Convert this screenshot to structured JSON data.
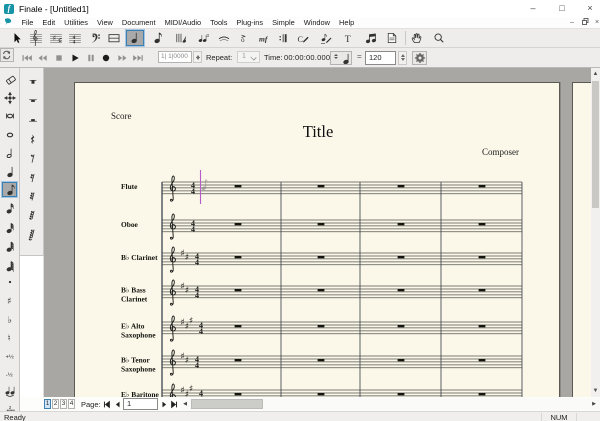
{
  "window": {
    "title": "Finale - [Untitled1]",
    "controls": {
      "minimize": "–",
      "maximize": "□",
      "close": "×"
    }
  },
  "menubar": {
    "items": [
      "File",
      "Edit",
      "Utilities",
      "View",
      "Document",
      "MIDI/Audio",
      "Tools",
      "Plug-ins",
      "Simple",
      "Window",
      "Help"
    ],
    "child_controls": {
      "minimize": "–",
      "restore": "▫",
      "close": "×"
    }
  },
  "toolbar_main": {
    "buttons": [
      {
        "name": "selection-tool",
        "icon": "cursor-arrow",
        "selected": false
      },
      {
        "name": "staff-tool",
        "icon": "treble-staff",
        "selected": false
      },
      {
        "name": "key-signature-tool",
        "icon": "key-signature-staff",
        "selected": false
      },
      {
        "name": "time-signature-tool",
        "icon": "time-signature-staff",
        "selected": false
      },
      {
        "name": "clef-tool",
        "icon": "bass-clef",
        "selected": false
      },
      {
        "name": "measure-tool",
        "icon": "measure-box",
        "selected": false
      },
      {
        "name": "simple-entry-tool",
        "icon": "quarter-note",
        "selected": true
      },
      {
        "name": "speedy-entry-tool",
        "icon": "eighth-note",
        "selected": false
      },
      {
        "name": "hyperscribe-tool",
        "icon": "hyperscribe",
        "selected": false
      },
      {
        "name": "tuplet-tool",
        "icon": "tuplet",
        "selected": false
      },
      {
        "name": "smart-shape-tool",
        "icon": "slur",
        "selected": false
      },
      {
        "name": "articulation-tool",
        "icon": "articulation",
        "selected": false
      },
      {
        "name": "expression-tool",
        "icon": "mf",
        "selected": false
      },
      {
        "name": "repeat-tool",
        "icon": "repeat-barline",
        "selected": false
      },
      {
        "name": "chord-tool",
        "icon": "chord",
        "selected": false
      },
      {
        "name": "lyrics-tool",
        "icon": "lyrics",
        "selected": false
      },
      {
        "name": "text-tool",
        "icon": "letter-t",
        "selected": false
      },
      {
        "name": "note-mover-tool",
        "icon": "beamed-notes",
        "selected": false
      },
      {
        "name": "page-layout-tool",
        "icon": "page",
        "selected": false
      },
      {
        "name": "hand-grabber-tool",
        "icon": "hand",
        "selected": false
      },
      {
        "name": "zoom-tool",
        "icon": "magnifier",
        "selected": false
      }
    ]
  },
  "toolbar_playback": {
    "loop_icon": "loop",
    "transport": [
      {
        "name": "skip-to-start",
        "icon": "skip-start",
        "enabled": false
      },
      {
        "name": "rewind",
        "icon": "rewind",
        "enabled": false
      },
      {
        "name": "stop",
        "icon": "stop",
        "enabled": false
      },
      {
        "name": "play",
        "icon": "play",
        "enabled": true
      },
      {
        "name": "pause",
        "icon": "pause",
        "enabled": false
      },
      {
        "name": "record",
        "icon": "record",
        "enabled": true
      },
      {
        "name": "fast-forward",
        "icon": "fast-forward",
        "enabled": false
      },
      {
        "name": "skip-to-end",
        "icon": "skip-end",
        "enabled": false
      }
    ],
    "counter_value": "1| 1|0000",
    "repeat_label": "Repeat:",
    "repeat_value": "1",
    "time_label": "Time:",
    "time_value": "00:00:00.000",
    "tempo_unit_icon": "quarter-note",
    "tempo_equals": "=",
    "tempo_value": "120",
    "settings_icon": "gear"
  },
  "palette_simple_entry": {
    "buttons": [
      {
        "name": "eraser",
        "icon": "eraser",
        "selected": false
      },
      {
        "name": "repitch",
        "icon": "move-arrows",
        "selected": false
      },
      {
        "name": "double-whole-note",
        "icon": "double-whole-note",
        "selected": false
      },
      {
        "name": "whole-note",
        "icon": "whole-note",
        "selected": false
      },
      {
        "name": "half-note",
        "icon": "half-note",
        "selected": false
      },
      {
        "name": "quarter-note",
        "icon": "quarter-note",
        "selected": false
      },
      {
        "name": "eighth-note",
        "icon": "eighth-note",
        "selected": true
      },
      {
        "name": "sixteenth-note",
        "icon": "sixteenth-note",
        "selected": false
      },
      {
        "name": "thirty-second-note",
        "icon": "thirty-second-note",
        "selected": false
      },
      {
        "name": "sixty-fourth-note",
        "icon": "sixty-fourth-note",
        "selected": false
      },
      {
        "name": "hundred-twenty-eighth-note",
        "icon": "hundred-twenty-eighth-note",
        "selected": false
      },
      {
        "name": "augmentation-dot",
        "icon": "dot",
        "selected": false
      },
      {
        "name": "sharp",
        "icon": "sharp",
        "selected": false
      },
      {
        "name": "flat",
        "icon": "flat",
        "selected": false
      },
      {
        "name": "natural",
        "icon": "natural",
        "selected": false
      },
      {
        "name": "half-step-up",
        "icon": "half-step-up",
        "selected": false
      },
      {
        "name": "half-step-down",
        "icon": "half-step-down",
        "selected": false
      },
      {
        "name": "tie",
        "icon": "tie",
        "selected": false
      },
      {
        "name": "tuplet",
        "icon": "tuplet-notes",
        "selected": false
      }
    ],
    "half_step_up_label": "+½",
    "half_step_down_label": "-½"
  },
  "palette_rests": {
    "buttons": [
      {
        "name": "double-whole-rest",
        "icon": "double-whole-rest"
      },
      {
        "name": "whole-rest",
        "icon": "whole-rest"
      },
      {
        "name": "half-rest",
        "icon": "half-rest"
      },
      {
        "name": "quarter-rest",
        "icon": "quarter-rest"
      },
      {
        "name": "eighth-rest",
        "icon": "eighth-rest"
      },
      {
        "name": "sixteenth-rest",
        "icon": "sixteenth-rest"
      },
      {
        "name": "thirty-second-rest",
        "icon": "thirty-second-rest"
      },
      {
        "name": "sixty-fourth-rest",
        "icon": "sixty-fourth-rest"
      },
      {
        "name": "hundred-twenty-eighth-rest",
        "icon": "hundred-twenty-eighth-rest"
      }
    ]
  },
  "document": {
    "part_name": "Score",
    "title": "Title",
    "composer": "Composer",
    "score": {
      "measures": 4,
      "time_signature": [
        "4",
        "4"
      ],
      "staves": [
        {
          "name": "Flute",
          "label_lines": [
            "Flute"
          ],
          "sharps": 0
        },
        {
          "name": "Oboe",
          "label_lines": [
            "Oboe"
          ],
          "sharps": 0
        },
        {
          "name": "Bb Clarinet",
          "label_lines": [
            "B♭ Clarinet"
          ],
          "sharps": 2
        },
        {
          "name": "Bb Bass Clarinet",
          "label_lines": [
            "B♭ Bass",
            "Clarinet"
          ],
          "sharps": 2
        },
        {
          "name": "Eb Alto Saxophone",
          "label_lines": [
            "E♭ Alto",
            "Saxophone"
          ],
          "sharps": 3
        },
        {
          "name": "Bb Tenor Saxophone",
          "label_lines": [
            "B♭ Tenor",
            "Saxophone"
          ],
          "sharps": 2
        },
        {
          "name": "Eb Baritone Saxophone",
          "label_lines": [
            "E♭ Baritone"
          ],
          "sharps": 3
        }
      ],
      "rest_type": "whole"
    }
  },
  "navbar": {
    "view_buttons": [
      "1",
      "2",
      "3",
      "4"
    ],
    "selected_view": "1",
    "page_label": "Page:",
    "page_value": "1"
  },
  "statusbar": {
    "ready": "Ready",
    "num": "NUM"
  },
  "colors": {
    "accent_selection": "#3c7fb1",
    "page_background": "#fbf8e9",
    "workspace_background": "#a8a7a4",
    "entry_cursor": "#b65cc8"
  }
}
